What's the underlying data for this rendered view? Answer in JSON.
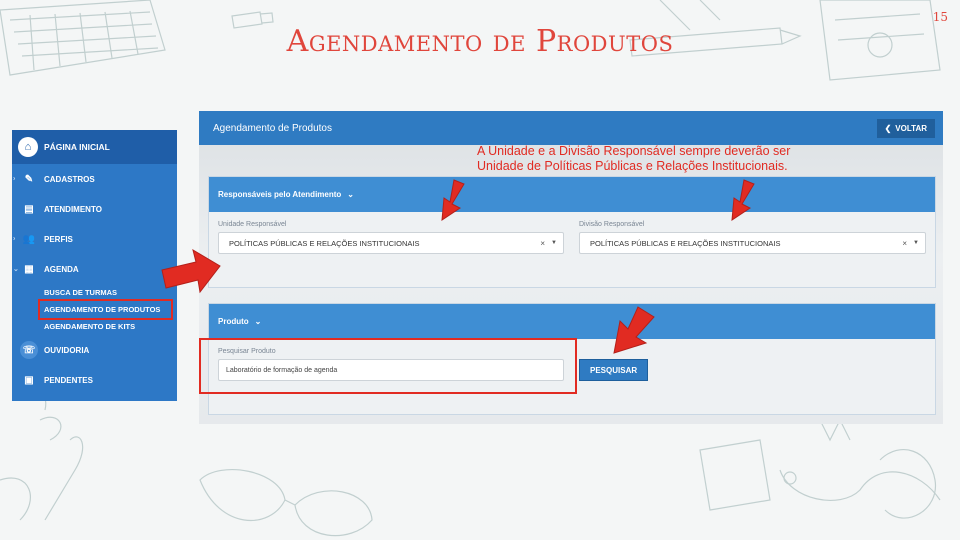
{
  "slide": {
    "title": "Agendamento de Produtos",
    "number": "15"
  },
  "sidebar": {
    "items": [
      {
        "label": "Página Inicial",
        "icon": "home-icon"
      },
      {
        "label": "Cadastros",
        "icon": "pencil-icon"
      },
      {
        "label": "Atendimento",
        "icon": "clipboard-icon"
      },
      {
        "label": "Perfis",
        "icon": "users-icon"
      },
      {
        "label": "Agenda",
        "icon": "calendar-icon"
      }
    ],
    "agenda_sub": [
      "Busca de Turmas",
      "Agendamento de Produtos",
      "Agendamento de Kits"
    ],
    "bottom_items": [
      {
        "label": "Ouvidoria",
        "icon": "ear-icon"
      },
      {
        "label": "Pendentes",
        "icon": "badge-icon"
      }
    ]
  },
  "app": {
    "title": "Agendamento de Produtos",
    "back_label": "VOLTAR",
    "responsaveis": {
      "heading": "Responsáveis pelo Atendimento",
      "unidade_label": "Unidade Responsável",
      "unidade_value": "POLÍTICAS PÚBLICAS E RELAÇÕES INSTITUCIONAIS",
      "divisao_label": "Divisão Responsável",
      "divisao_value": "POLÍTICAS PÚBLICAS E RELAÇÕES INSTITUCIONAIS"
    },
    "produto": {
      "heading": "Produto",
      "search_label": "Pesquisar Produto",
      "search_value": "Laboratório de formação de agenda",
      "search_button": "PESQUISAR"
    }
  },
  "annotation": {
    "line1": "A Unidade e a Divisão Responsável sempre deverão ser",
    "line2": "Unidade de Políticas Públicas e Relações Institucionais."
  },
  "colors": {
    "accent_red": "#e12b22",
    "primary_blue": "#2f7bc2",
    "sidebar_blue": "#2d78c6"
  }
}
